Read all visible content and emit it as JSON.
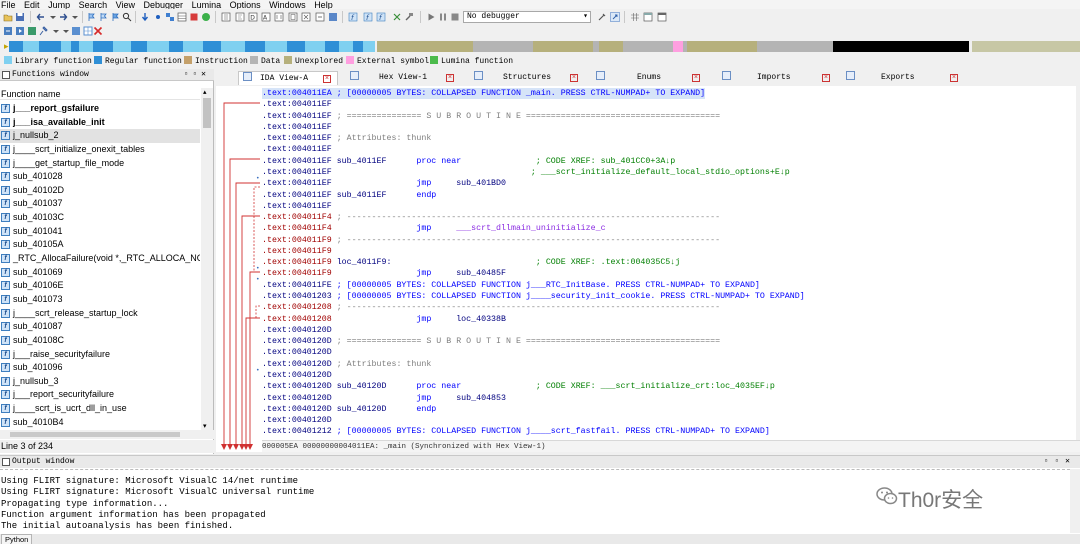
{
  "menu": [
    "File",
    "Edit",
    "Jump",
    "Search",
    "View",
    "Debugger",
    "Lumina",
    "Options",
    "Windows",
    "Help"
  ],
  "toolbar": {
    "debugger_select": "No debugger"
  },
  "nav_band_colors": {
    "library": "#7fd0f0",
    "regular": "#2f8fd6",
    "instruction": "#c4a06a",
    "data": "#b4b4b4",
    "unexplored": "#b6b07c",
    "external": "#ff9fe0",
    "lumina": "#4cbb4c",
    "black": "#000000"
  },
  "legend": [
    {
      "label": "Library function",
      "color": "#7fd0f0"
    },
    {
      "label": "Regular function",
      "color": "#2f8fd6"
    },
    {
      "label": "Instruction",
      "color": "#c4a06a"
    },
    {
      "label": "Data",
      "color": "#b4b4b4"
    },
    {
      "label": "Unexplored",
      "color": "#b6b07c"
    },
    {
      "label": "External symbol",
      "color": "#ff9fe0"
    },
    {
      "label": "Lumina function",
      "color": "#4cbb4c"
    }
  ],
  "functions": {
    "title": "Functions window",
    "column": "Function name",
    "items": [
      {
        "name": "j___report_gsfailure",
        "bold": true
      },
      {
        "name": "j___isa_available_init",
        "bold": true
      },
      {
        "name": "j_nullsub_2",
        "bold": false,
        "selected": true
      },
      {
        "name": "j____scrt_initialize_onexit_tables",
        "bold": false
      },
      {
        "name": "j____get_startup_file_mode",
        "bold": false
      },
      {
        "name": "sub_401028",
        "bold": false
      },
      {
        "name": "sub_40102D",
        "bold": false
      },
      {
        "name": "sub_401037",
        "bold": false
      },
      {
        "name": "sub_40103C",
        "bold": false
      },
      {
        "name": "sub_401041",
        "bold": false
      },
      {
        "name": "sub_40105A",
        "bold": false
      },
      {
        "name": "_RTC_AllocaFailure(void *,_RTC_ALLOCA_NODE *,int)",
        "bold": false
      },
      {
        "name": "sub_401069",
        "bold": false
      },
      {
        "name": "sub_40106E",
        "bold": false
      },
      {
        "name": "sub_401073",
        "bold": false
      },
      {
        "name": "j____scrt_release_startup_lock",
        "bold": false
      },
      {
        "name": "sub_401087",
        "bold": false
      },
      {
        "name": "sub_40108C",
        "bold": false
      },
      {
        "name": "j___raise_securityfailure",
        "bold": false
      },
      {
        "name": "sub_401096",
        "bold": false
      },
      {
        "name": "j_nullsub_3",
        "bold": false
      },
      {
        "name": "j___report_securityfailure",
        "bold": false
      },
      {
        "name": "j____scrt_is_ucrt_dll_in_use",
        "bold": false
      },
      {
        "name": "sub_4010B4",
        "bold": false
      }
    ],
    "status": "Line 3 of 234"
  },
  "tabs": [
    {
      "label": "IDA View-A",
      "active": true
    },
    {
      "label": "Hex View-1",
      "active": false
    },
    {
      "label": "Structures",
      "active": false
    },
    {
      "label": "Enums",
      "active": false
    },
    {
      "label": "Imports",
      "active": false
    },
    {
      "label": "Exports",
      "active": false
    }
  ],
  "disasm": [
    {
      "addr": ".text:004011EA",
      "seg": "blue",
      "hl": true,
      "parts": [
        {
          "t": " ; [00000005 BYTES: COLLAPSED FUNCTION _main. PRESS CTRL-NUMPAD+ TO EXPAND]",
          "c": "blue"
        }
      ]
    },
    {
      "addr": ".text:004011EF",
      "seg": "seg",
      "parts": []
    },
    {
      "addr": ".text:004011EF",
      "seg": "seg",
      "parts": [
        {
          "t": " ; =============== S U B R O U T I N E =======================================",
          "c": "cmt"
        }
      ]
    },
    {
      "addr": ".text:004011EF",
      "seg": "seg",
      "parts": []
    },
    {
      "addr": ".text:004011EF",
      "seg": "seg",
      "parts": [
        {
          "t": " ; Attributes: thunk",
          "c": "cmt"
        }
      ]
    },
    {
      "addr": ".text:004011EF",
      "seg": "seg",
      "parts": []
    },
    {
      "addr": ".text:004011EF",
      "seg": "seg",
      "parts": [
        {
          "t": " sub_4011EF      ",
          "c": "navy"
        },
        {
          "t": "proc near",
          "c": "blue"
        },
        {
          "t": "               ; CODE XREF: sub_401CC0+3A↓p",
          "c": "green"
        }
      ]
    },
    {
      "addr": ".text:004011EF",
      "seg": "seg",
      "parts": [
        {
          "t": "                                        ; ___scrt_initialize_default_local_stdio_options+E↓p",
          "c": "green"
        }
      ]
    },
    {
      "addr": ".text:004011EF",
      "seg": "seg",
      "parts": [
        {
          "t": "                 ",
          "c": "navy"
        },
        {
          "t": "jmp",
          "c": "blue"
        },
        {
          "t": "     sub_401BD0",
          "c": "navy"
        }
      ]
    },
    {
      "addr": ".text:004011EF",
      "seg": "seg",
      "parts": [
        {
          "t": " sub_4011EF      ",
          "c": "navy"
        },
        {
          "t": "endp",
          "c": "blue"
        }
      ]
    },
    {
      "addr": ".text:004011EF",
      "seg": "seg",
      "parts": []
    },
    {
      "addr": ".text:004011F4",
      "seg": "seg-red",
      "parts": [
        {
          "t": " ; ---------------------------------------------------------------------------",
          "c": "cmt"
        }
      ]
    },
    {
      "addr": ".text:004011F4",
      "seg": "seg-red",
      "parts": [
        {
          "t": "                 ",
          "c": "navy"
        },
        {
          "t": "jmp",
          "c": "blue"
        },
        {
          "t": "     ___scrt_dllmain_uninitialize_c",
          "c": "purple"
        }
      ]
    },
    {
      "addr": ".text:004011F9",
      "seg": "seg-red",
      "parts": [
        {
          "t": " ; ---------------------------------------------------------------------------",
          "c": "cmt"
        }
      ]
    },
    {
      "addr": ".text:004011F9",
      "seg": "seg-red",
      "parts": []
    },
    {
      "addr": ".text:004011F9",
      "seg": "seg-red",
      "parts": [
        {
          "t": " loc_4011F9:                             ",
          "c": "navy"
        },
        {
          "t": "; CODE XREF: .text:004035C5↓j",
          "c": "green"
        }
      ]
    },
    {
      "addr": ".text:004011F9",
      "seg": "seg-red",
      "parts": [
        {
          "t": "                 ",
          "c": "navy"
        },
        {
          "t": "jmp",
          "c": "blue"
        },
        {
          "t": "     sub_40485F",
          "c": "navy"
        }
      ]
    },
    {
      "addr": ".text:004011FE",
      "seg": "seg",
      "parts": [
        {
          "t": " ; [00000005 BYTES: COLLAPSED FUNCTION j___RTC_InitBase. PRESS CTRL-NUMPAD+ TO EXPAND]",
          "c": "blue"
        }
      ]
    },
    {
      "addr": ".text:00401203",
      "seg": "seg",
      "parts": [
        {
          "t": " ; [00000005 BYTES: COLLAPSED FUNCTION j____security_init_cookie. PRESS CTRL-NUMPAD+ TO EXPAND]",
          "c": "blue"
        }
      ]
    },
    {
      "addr": ".text:00401208",
      "seg": "seg-red",
      "parts": [
        {
          "t": " ; ---------------------------------------------------------------------------",
          "c": "cmt"
        }
      ]
    },
    {
      "addr": ".text:00401208",
      "seg": "seg-red",
      "parts": [
        {
          "t": "                 ",
          "c": "navy"
        },
        {
          "t": "jmp",
          "c": "blue"
        },
        {
          "t": "     loc_40338B",
          "c": "navy"
        }
      ]
    },
    {
      "addr": ".text:0040120D",
      "seg": "seg",
      "parts": []
    },
    {
      "addr": ".text:0040120D",
      "seg": "seg",
      "parts": [
        {
          "t": " ; =============== S U B R O U T I N E =======================================",
          "c": "cmt"
        }
      ]
    },
    {
      "addr": ".text:0040120D",
      "seg": "seg",
      "parts": []
    },
    {
      "addr": ".text:0040120D",
      "seg": "seg",
      "parts": [
        {
          "t": " ; Attributes: thunk",
          "c": "cmt"
        }
      ]
    },
    {
      "addr": ".text:0040120D",
      "seg": "seg",
      "parts": []
    },
    {
      "addr": ".text:0040120D",
      "seg": "seg",
      "parts": [
        {
          "t": " sub_40120D      ",
          "c": "navy"
        },
        {
          "t": "proc near",
          "c": "blue"
        },
        {
          "t": "               ; CODE XREF: ___scrt_initialize_crt:loc_4035EF↓p",
          "c": "green"
        }
      ]
    },
    {
      "addr": ".text:0040120D",
      "seg": "seg",
      "parts": [
        {
          "t": "                 ",
          "c": "navy"
        },
        {
          "t": "jmp",
          "c": "blue"
        },
        {
          "t": "     sub_404853",
          "c": "navy"
        }
      ]
    },
    {
      "addr": ".text:0040120D",
      "seg": "seg",
      "parts": [
        {
          "t": " sub_40120D      ",
          "c": "navy"
        },
        {
          "t": "endp",
          "c": "blue"
        }
      ]
    },
    {
      "addr": ".text:0040120D",
      "seg": "seg",
      "parts": []
    },
    {
      "addr": ".text:00401212",
      "seg": "seg",
      "parts": [
        {
          "t": " ; [00000005 BYTES: COLLAPSED FUNCTION j____scrt_fastfail. PRESS CTRL-NUMPAD+ TO EXPAND]",
          "c": "blue"
        }
      ]
    }
  ],
  "disasm_status": "000005EA 00000000004011EA: _main (Synchronized with Hex View-1)",
  "output": {
    "title": "Output window",
    "lines": [
      "Using FLIRT signature: Microsoft VisualC 14/net runtime",
      "Using FLIRT signature: Microsoft VisualC universal runtime",
      "Propagating type information...",
      "Function argument information has been propagated",
      "The initial autoanalysis has been finished."
    ],
    "lang_button": "Python"
  },
  "watermark": "Th0r安全"
}
